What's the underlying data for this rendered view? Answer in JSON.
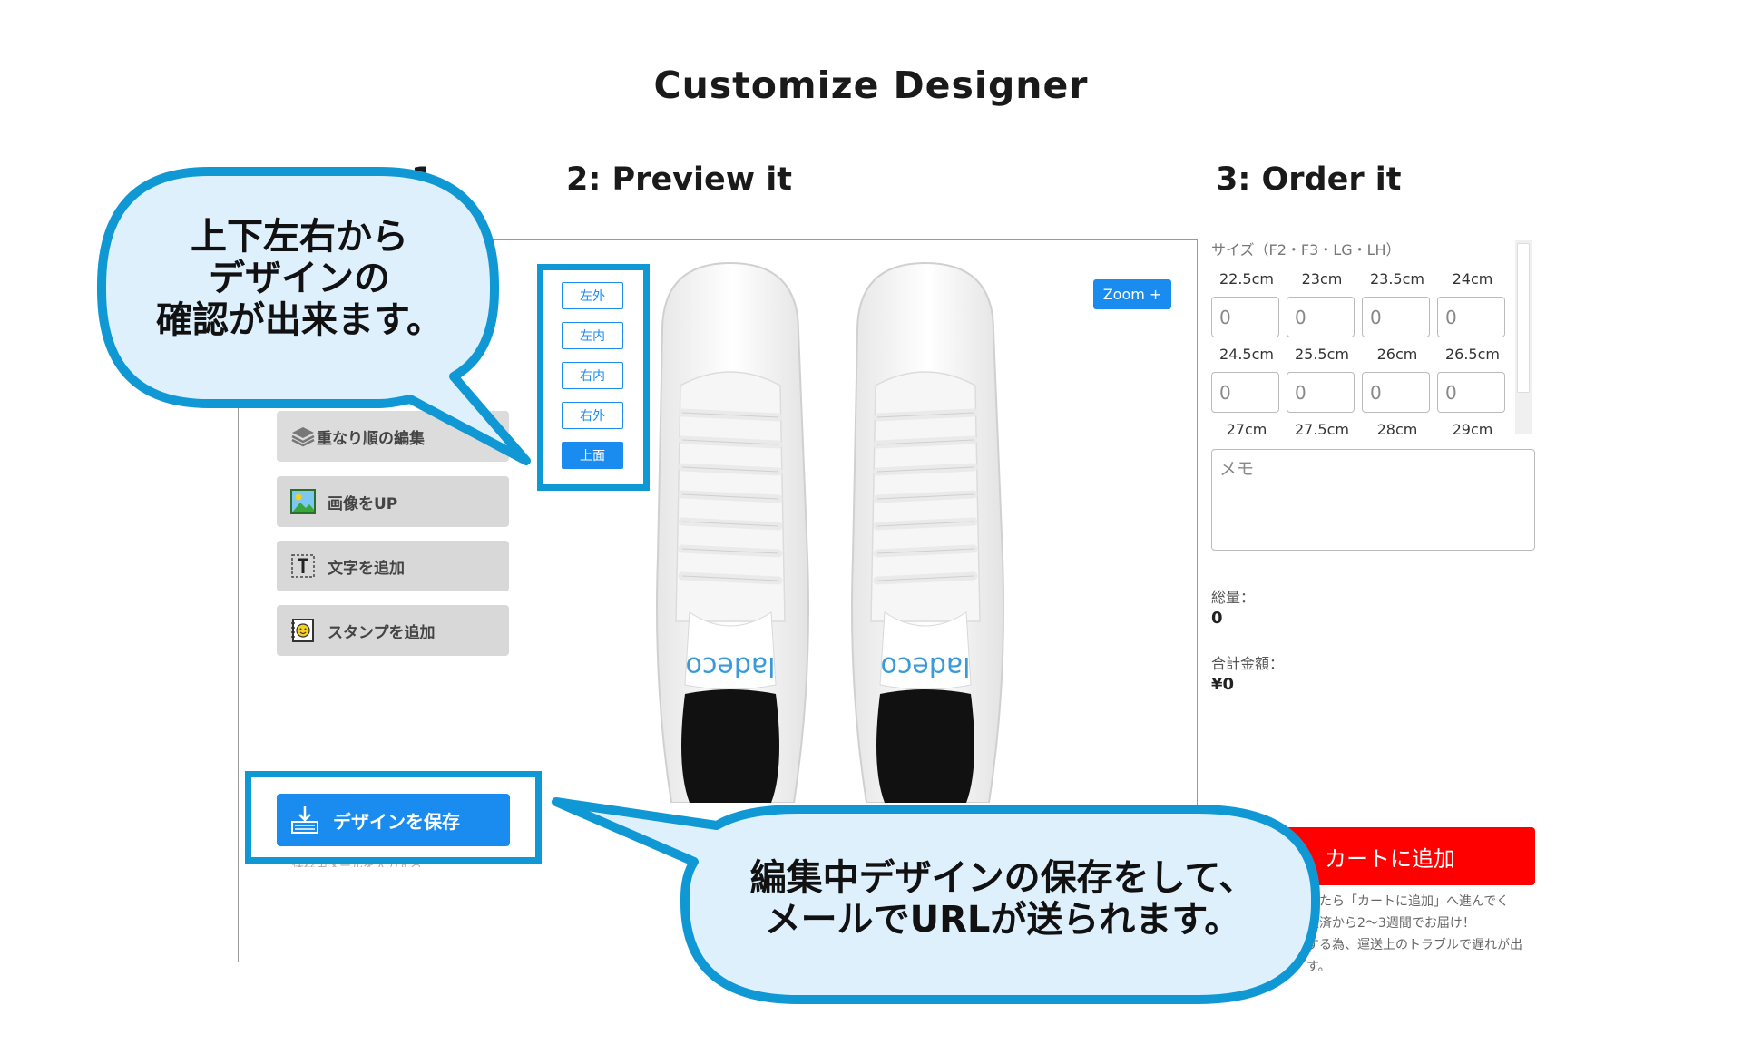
{
  "page": {
    "title": "Customize Designer"
  },
  "steps": {
    "step1_fragment": "1",
    "step2": "2: Preview it",
    "step3": "3: Order it"
  },
  "tools": [
    {
      "label": "重なり順の編集",
      "icon": "layers-icon"
    },
    {
      "label": "画像をUP",
      "icon": "image-icon"
    },
    {
      "label": "文字を追加",
      "icon": "text-icon"
    },
    {
      "label": "スタンプを追加",
      "icon": "stamp-icon"
    }
  ],
  "save": {
    "label": "デザインを保存",
    "icon": "download-icon",
    "subtext": "保存用メールを入力する"
  },
  "views": [
    {
      "label": "左外",
      "active": false
    },
    {
      "label": "左内",
      "active": false
    },
    {
      "label": "右内",
      "active": false
    },
    {
      "label": "右外",
      "active": false
    },
    {
      "label": "上面",
      "active": true
    }
  ],
  "zoom": {
    "label": "Zoom +"
  },
  "shoe": {
    "brand_text": "ladeco",
    "description": "white sneakers top view"
  },
  "order": {
    "size_hint": "サイズ（F2・F3・LG・LH）",
    "sizes_row1": [
      "22.5cm",
      "23cm",
      "23.5cm",
      "24cm"
    ],
    "qty_row1": [
      "0",
      "0",
      "0",
      "0"
    ],
    "sizes_row2": [
      "24.5cm",
      "25.5cm",
      "26cm",
      "26.5cm"
    ],
    "qty_row2": [
      "0",
      "0",
      "0",
      "0"
    ],
    "sizes_row3": [
      "27cm",
      "27.5cm",
      "28cm",
      "29cm"
    ],
    "memo_placeholder": "メモ",
    "total_qty_label": "総量：",
    "total_qty_value": "0",
    "total_price_label": "合計金額：",
    "total_price_value": "¥0",
    "cart_label": "カートに追加",
    "note_line1": "したら「カートに追加」へ進んでく",
    "note_line2": "決済から2〜3週間でお届け！",
    "note_line3": "する為、運送上のトラブルで遅れが出",
    "note_line4": "す。"
  },
  "callouts": {
    "top_line1": "上下左右から",
    "top_line2": "デザインの",
    "top_line3": "確認が出来ます。",
    "bottom_line1": "編集中デザインの保存をして、",
    "bottom_line2": "メールでURLが送られます。"
  },
  "colors": {
    "accent": "#1a8cf0",
    "callout_border": "#0f98d4",
    "callout_fill": "#dff0fd",
    "cart": "#ff0000"
  }
}
